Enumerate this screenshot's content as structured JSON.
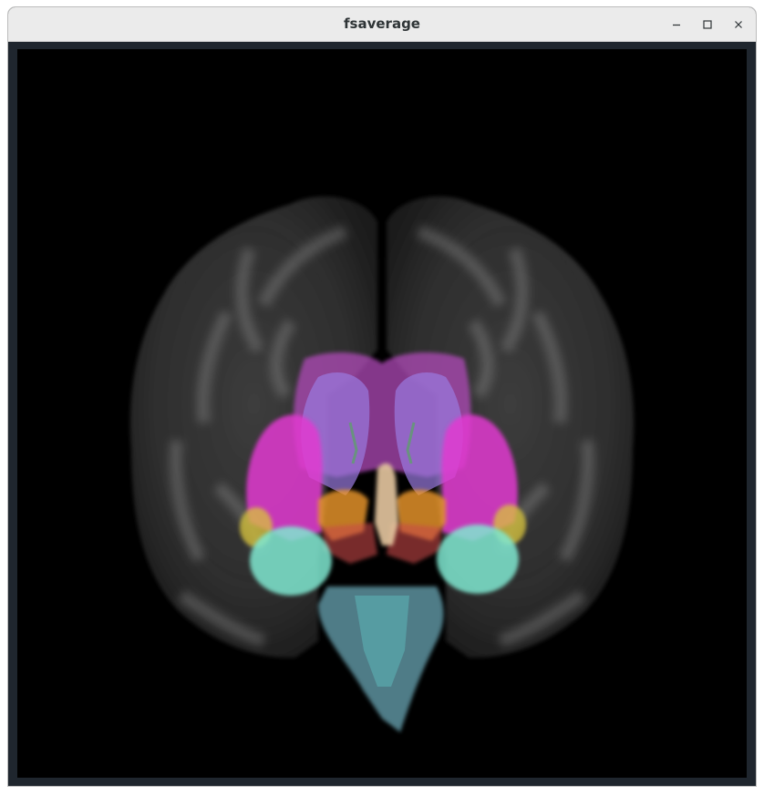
{
  "window": {
    "title": "fsaverage",
    "controls": {
      "minimize_icon": "minimize-icon",
      "maximize_icon": "maximize-icon",
      "close_icon": "close-icon"
    }
  },
  "scene": {
    "background": "#000000",
    "structures": [
      {
        "name": "cortex-left-hemisphere",
        "color": "#8a8a8a"
      },
      {
        "name": "cortex-right-hemisphere",
        "color": "#8a8a8a"
      },
      {
        "name": "thalamus",
        "color": "#b04ab8"
      },
      {
        "name": "putamen-left",
        "color": "#e23bd0"
      },
      {
        "name": "putamen-right",
        "color": "#e23bd0"
      },
      {
        "name": "caudate-left",
        "color": "#9a7be0"
      },
      {
        "name": "caudate-right",
        "color": "#9a7be0"
      },
      {
        "name": "amygdala-left",
        "color": "#7fe8d0"
      },
      {
        "name": "amygdala-right",
        "color": "#7fe8d0"
      },
      {
        "name": "pallidum-left",
        "color": "#f09a2c"
      },
      {
        "name": "pallidum-right",
        "color": "#f09a2c"
      },
      {
        "name": "ventral-dc-left",
        "color": "#c84a4a"
      },
      {
        "name": "ventral-dc-right",
        "color": "#c84a4a"
      },
      {
        "name": "brainstem",
        "color": "#6aa6b4"
      },
      {
        "name": "third-ventricle",
        "color": "#e6c7a0"
      },
      {
        "name": "accumbens-left",
        "color": "#d8c43a"
      },
      {
        "name": "accumbens-right",
        "color": "#d8c43a"
      }
    ]
  }
}
